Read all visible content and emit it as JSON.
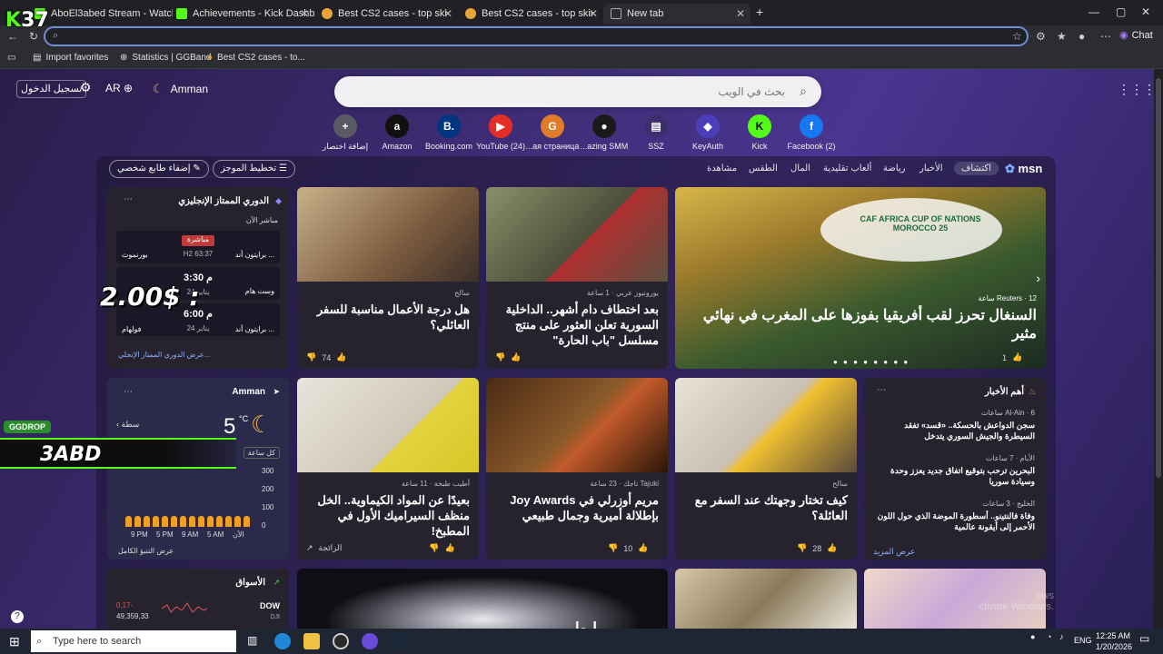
{
  "tabs": [
    {
      "label": "AboEl3abed Stream - Watch Live o",
      "color": "#53fc18"
    },
    {
      "label": "Achievements - Kick Dashboard",
      "color": "#53fc18"
    },
    {
      "label": "Best CS2 cases - top skins in CSGO",
      "color": "#e8a33a"
    },
    {
      "label": "Best CS2 cases - top skins in CSGO",
      "color": "#e8a33a"
    },
    {
      "label": "New tab",
      "color": "#8fb0e8"
    }
  ],
  "window": {
    "minimize": "—",
    "maximize": "▢",
    "close": "✕"
  },
  "address": {
    "value": "",
    "chat_label": "Chat"
  },
  "favorites": [
    {
      "label": "Import favorites"
    },
    {
      "label": "Statistics | GGBand"
    },
    {
      "label": "Best CS2 cases - to..."
    }
  ],
  "header": {
    "signin": "تسجيل الدخول",
    "language": "AR",
    "city": "Amman"
  },
  "search": {
    "placeholder": "بحث في الويب"
  },
  "shortcuts": [
    {
      "label": "إضافة اختصار",
      "glyph": "+",
      "color": "#5a5a66"
    },
    {
      "label": "Amazon",
      "glyph": "a",
      "color": "#111111"
    },
    {
      "label": "Booking.com",
      "glyph": "B.",
      "color": "#003580"
    },
    {
      "label": "YouTube (24)",
      "glyph": "▶",
      "color": "#e52d27"
    },
    {
      "label": "...ая страница",
      "glyph": "G",
      "color": "#e07b2a"
    },
    {
      "label": "...azing SMM",
      "glyph": "●",
      "color": "#1a1a1a"
    },
    {
      "label": "SSZ",
      "glyph": "▤",
      "color": "#3b2f6e"
    },
    {
      "label": "KeyAuth",
      "glyph": "◆",
      "color": "#4a3fb8"
    },
    {
      "label": "Kick",
      "glyph": "K",
      "color": "#53fc18"
    },
    {
      "label": "Facebook (2)",
      "glyph": "f",
      "color": "#1877f2"
    }
  ],
  "feed_nav": {
    "brand": "msn",
    "items": [
      "اكتشاف",
      "الأخبار",
      "رياضة",
      "ألعاب تقليدية",
      "المال",
      "الطقس",
      "مشاهدة"
    ],
    "personalize": "إضفاء طابع شخصي",
    "layout": "تخطيط الموجز"
  },
  "sports": {
    "title": "الدوري الممتاز الإنجليزي",
    "live_label": "مباشر الآن",
    "matches": [
      {
        "home": "برايتون أند ...",
        "away": "بورنموث",
        "status": "مباشرة",
        "detail": "H2 63:37"
      },
      {
        "home": "وست هام",
        "away": "...",
        "status": "3:30 م",
        "detail": "24 يناير"
      },
      {
        "home": "برايتون أند ...",
        "away": "فولهام",
        "status": "6:00 م",
        "detail": "24 يناير"
      }
    ],
    "footer": "عرض الدوري الممتاز الإنجلي..."
  },
  "weather": {
    "city": "Amman",
    "temp": "5",
    "unit": "°C",
    "tab": "كل ساعة",
    "axis": [
      "300",
      "200",
      "100",
      "0"
    ],
    "times": [
      "9 PM",
      "5 PM",
      "9 AM",
      "5 AM",
      "الآن"
    ],
    "footer": "عرض التنبؤ الكامل",
    "back": "سطة"
  },
  "markets": {
    "title": "الأسواق",
    "ticker": "DOW",
    "sub": "DJI",
    "change": "0,17-",
    "value": "49,359,33"
  },
  "hero": {
    "source": "Reuters · 12 ساعة",
    "title": "السنغال تحرز لقب أفريقيا بفوزها على المغرب في نهائي مثير",
    "likes": "1",
    "banner": "CAF AFRICA CUP OF NATIONS MOROCCO 25"
  },
  "cards": [
    {
      "source": "يورونيوز عربي · 1 ساعة",
      "title": "بعد اختطاف دام أشهر.. الداخلية السورية تعلن العثور على منتج مسلسل \"باب الحارة\"",
      "likes": ""
    },
    {
      "source": "سالح",
      "title": "هل درجة الأعمال مناسبة للسفر العائلي؟",
      "likes": "74"
    },
    {
      "source": "سالح",
      "title": "كيف تختار وجهتك عند السفر مع العائلة؟",
      "likes": "28"
    },
    {
      "source": "Tajuki تاجك · 23 ساعة",
      "title": "مريم أوزرلي في Joy Awards بإطلالة أميرية وجمال طبيعي",
      "likes": "10"
    },
    {
      "source": "أطيب طبخة · 11 ساعة",
      "title": "بعيدًا عن المواد الكيماوية.. الخل منظف السيراميك الأول في المطبخ!",
      "likes": "",
      "tag": "الرائجة"
    }
  ],
  "top_news": {
    "title": "أهم الأخبار",
    "items": [
      {
        "source": "Al-Ain · 6 ساعات",
        "headline": "سجن الدواعش بالحسكة.. «قسد» تفقد السيطرة والجيش السوري يتدخل"
      },
      {
        "source": "الأيام · 7 ساعات",
        "headline": "البحرين ترحب بتوقيع اتفاق جديد يعزز وحدة وسيادة سوريا"
      },
      {
        "source": "الخليج · 3 ساعات",
        "headline": "وفاة فالنتينو.. أسطورة الموضة الذي حول اللون الأحمر إلى أيقونة عالمية"
      }
    ],
    "more": "عرض المزيد"
  },
  "overlays": {
    "k37_prefix": "K",
    "k37_num": "37",
    "price": "2.00$ :",
    "gg_badge": "GGDROP",
    "gg_name": "3ABD",
    "ov_text": "رابط",
    "watermark_1": "ows",
    "watermark_2": "ctivate Windows."
  },
  "taskbar": {
    "search_placeholder": "Type here to search",
    "lang": "ENG",
    "time": "12:25 AM",
    "date": "1/20/2026"
  }
}
